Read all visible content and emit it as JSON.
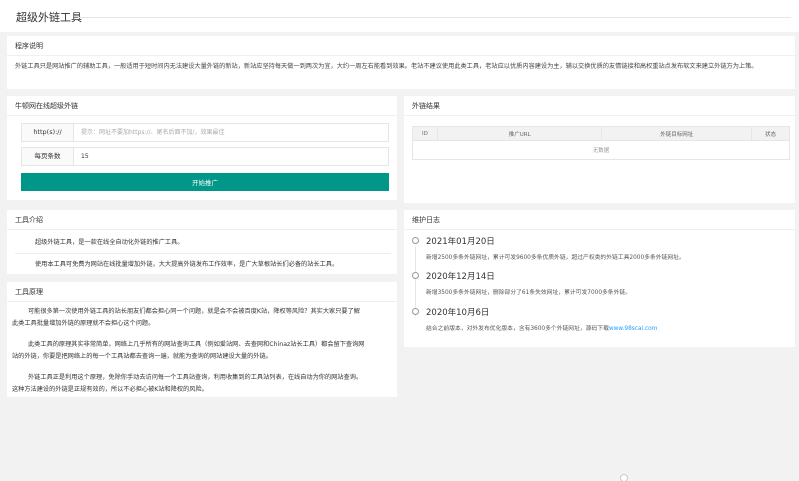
{
  "header": {
    "title": "超级外链工具"
  },
  "desc": {
    "title": "程序说明",
    "text": "外链工具只是网站推广的辅助工具，一般适用于短时间内无法建设大量外链的新站，新站应坚持每天做一到两次为宜，大约一周左右能看到效果。老站不建议使用此类工具，老站应以优质内容建设为主，辅以交换优质的友情链接和高权重站点发布软文来建立外链方为上策。"
  },
  "form": {
    "title": "牛顿网在线超级外链",
    "proto_label": "http(s)://",
    "url_placeholder": "提示：网址不要加https://、尾名后面不加/，效果最佳",
    "url_value": "",
    "per_page_label": "每页条数",
    "per_page_value": "15",
    "submit_label": "开始推广"
  },
  "results": {
    "title": "外链结果",
    "columns": [
      "ID",
      "推广URL",
      "外链目标网址",
      "状态"
    ],
    "empty_text": "无数据"
  },
  "intro": {
    "title": "工具介绍",
    "lines": [
      "超级外链工具，是一款在线全自动化外链的推广工具。",
      "使用本工具可免费为网站在线批量增加外链，大大提高外链发布工作效率，是广大草根站长们必备的站长工具。"
    ]
  },
  "principle": {
    "title": "工具原理",
    "p1a": "可能很多第一次使用外链工具的站长朋友们都会担心同一个问题，就是会不会被百度K站，降权等风险？其实大家只要了解",
    "p1b": "此类工具批量增加外链的原理就不会担心这个问题。",
    "p2a": "此类工具的原理其实非常简单，网络上几乎所有的网站查询工具（例如爱站网、去查网和Chinaz站长工具）都会留下查询网",
    "p2b": "站的外链，你要是把网络上的每一个工具站都去查询一遍，就能为查询的网站建设大量的外链。",
    "p3a": "外链工具正是利用这个原理，免除你手动去访问每一个工具站查询，利用收集到的工具站列表，在线自动为你的网站查询。",
    "p3b": "这种方法建设的外链是正规有效的，所以不必担心被K站和降权的风险。"
  },
  "changelog": {
    "title": "维护日志",
    "entries": [
      {
        "date": "2021年01月20日",
        "text": "新增2500多条外链网址，累计可发9600多条优质外链，超过产权类的外链工具2000多条外链网址。"
      },
      {
        "date": "2020年12月14日",
        "text": "新增3500多条外链网址，删除部分了61条失效网址，累计可发7000多条外链。"
      },
      {
        "date": "2020年10月6日",
        "text": "结合之前版本，对外发布优化版本，含有3600多个外链网址，源码下载",
        "link": "www.98scai.com"
      }
    ]
  }
}
